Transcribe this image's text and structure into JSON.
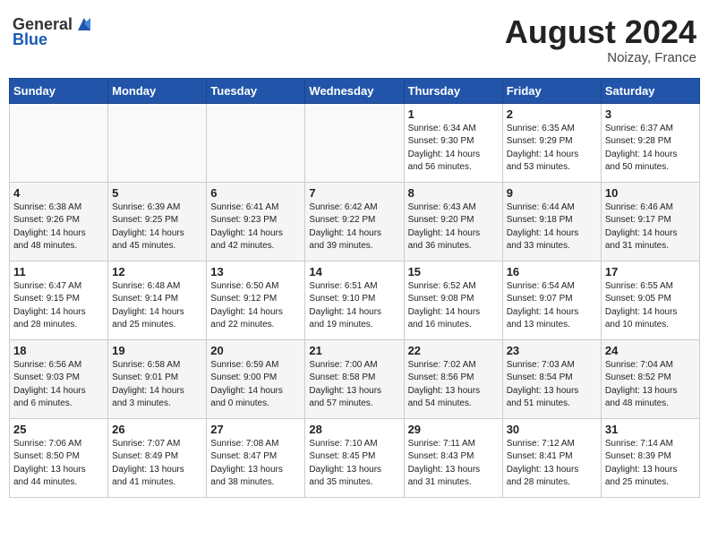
{
  "header": {
    "logo_general": "General",
    "logo_blue": "Blue",
    "title": "August 2024",
    "subtitle": "Noizay, France"
  },
  "days_of_week": [
    "Sunday",
    "Monday",
    "Tuesday",
    "Wednesday",
    "Thursday",
    "Friday",
    "Saturday"
  ],
  "weeks": [
    [
      {
        "day": "",
        "info": ""
      },
      {
        "day": "",
        "info": ""
      },
      {
        "day": "",
        "info": ""
      },
      {
        "day": "",
        "info": ""
      },
      {
        "day": "1",
        "info": "Sunrise: 6:34 AM\nSunset: 9:30 PM\nDaylight: 14 hours\nand 56 minutes."
      },
      {
        "day": "2",
        "info": "Sunrise: 6:35 AM\nSunset: 9:29 PM\nDaylight: 14 hours\nand 53 minutes."
      },
      {
        "day": "3",
        "info": "Sunrise: 6:37 AM\nSunset: 9:28 PM\nDaylight: 14 hours\nand 50 minutes."
      }
    ],
    [
      {
        "day": "4",
        "info": "Sunrise: 6:38 AM\nSunset: 9:26 PM\nDaylight: 14 hours\nand 48 minutes."
      },
      {
        "day": "5",
        "info": "Sunrise: 6:39 AM\nSunset: 9:25 PM\nDaylight: 14 hours\nand 45 minutes."
      },
      {
        "day": "6",
        "info": "Sunrise: 6:41 AM\nSunset: 9:23 PM\nDaylight: 14 hours\nand 42 minutes."
      },
      {
        "day": "7",
        "info": "Sunrise: 6:42 AM\nSunset: 9:22 PM\nDaylight: 14 hours\nand 39 minutes."
      },
      {
        "day": "8",
        "info": "Sunrise: 6:43 AM\nSunset: 9:20 PM\nDaylight: 14 hours\nand 36 minutes."
      },
      {
        "day": "9",
        "info": "Sunrise: 6:44 AM\nSunset: 9:18 PM\nDaylight: 14 hours\nand 33 minutes."
      },
      {
        "day": "10",
        "info": "Sunrise: 6:46 AM\nSunset: 9:17 PM\nDaylight: 14 hours\nand 31 minutes."
      }
    ],
    [
      {
        "day": "11",
        "info": "Sunrise: 6:47 AM\nSunset: 9:15 PM\nDaylight: 14 hours\nand 28 minutes."
      },
      {
        "day": "12",
        "info": "Sunrise: 6:48 AM\nSunset: 9:14 PM\nDaylight: 14 hours\nand 25 minutes."
      },
      {
        "day": "13",
        "info": "Sunrise: 6:50 AM\nSunset: 9:12 PM\nDaylight: 14 hours\nand 22 minutes."
      },
      {
        "day": "14",
        "info": "Sunrise: 6:51 AM\nSunset: 9:10 PM\nDaylight: 14 hours\nand 19 minutes."
      },
      {
        "day": "15",
        "info": "Sunrise: 6:52 AM\nSunset: 9:08 PM\nDaylight: 14 hours\nand 16 minutes."
      },
      {
        "day": "16",
        "info": "Sunrise: 6:54 AM\nSunset: 9:07 PM\nDaylight: 14 hours\nand 13 minutes."
      },
      {
        "day": "17",
        "info": "Sunrise: 6:55 AM\nSunset: 9:05 PM\nDaylight: 14 hours\nand 10 minutes."
      }
    ],
    [
      {
        "day": "18",
        "info": "Sunrise: 6:56 AM\nSunset: 9:03 PM\nDaylight: 14 hours\nand 6 minutes."
      },
      {
        "day": "19",
        "info": "Sunrise: 6:58 AM\nSunset: 9:01 PM\nDaylight: 14 hours\nand 3 minutes."
      },
      {
        "day": "20",
        "info": "Sunrise: 6:59 AM\nSunset: 9:00 PM\nDaylight: 14 hours\nand 0 minutes."
      },
      {
        "day": "21",
        "info": "Sunrise: 7:00 AM\nSunset: 8:58 PM\nDaylight: 13 hours\nand 57 minutes."
      },
      {
        "day": "22",
        "info": "Sunrise: 7:02 AM\nSunset: 8:56 PM\nDaylight: 13 hours\nand 54 minutes."
      },
      {
        "day": "23",
        "info": "Sunrise: 7:03 AM\nSunset: 8:54 PM\nDaylight: 13 hours\nand 51 minutes."
      },
      {
        "day": "24",
        "info": "Sunrise: 7:04 AM\nSunset: 8:52 PM\nDaylight: 13 hours\nand 48 minutes."
      }
    ],
    [
      {
        "day": "25",
        "info": "Sunrise: 7:06 AM\nSunset: 8:50 PM\nDaylight: 13 hours\nand 44 minutes."
      },
      {
        "day": "26",
        "info": "Sunrise: 7:07 AM\nSunset: 8:49 PM\nDaylight: 13 hours\nand 41 minutes."
      },
      {
        "day": "27",
        "info": "Sunrise: 7:08 AM\nSunset: 8:47 PM\nDaylight: 13 hours\nand 38 minutes."
      },
      {
        "day": "28",
        "info": "Sunrise: 7:10 AM\nSunset: 8:45 PM\nDaylight: 13 hours\nand 35 minutes."
      },
      {
        "day": "29",
        "info": "Sunrise: 7:11 AM\nSunset: 8:43 PM\nDaylight: 13 hours\nand 31 minutes."
      },
      {
        "day": "30",
        "info": "Sunrise: 7:12 AM\nSunset: 8:41 PM\nDaylight: 13 hours\nand 28 minutes."
      },
      {
        "day": "31",
        "info": "Sunrise: 7:14 AM\nSunset: 8:39 PM\nDaylight: 13 hours\nand 25 minutes."
      }
    ]
  ]
}
